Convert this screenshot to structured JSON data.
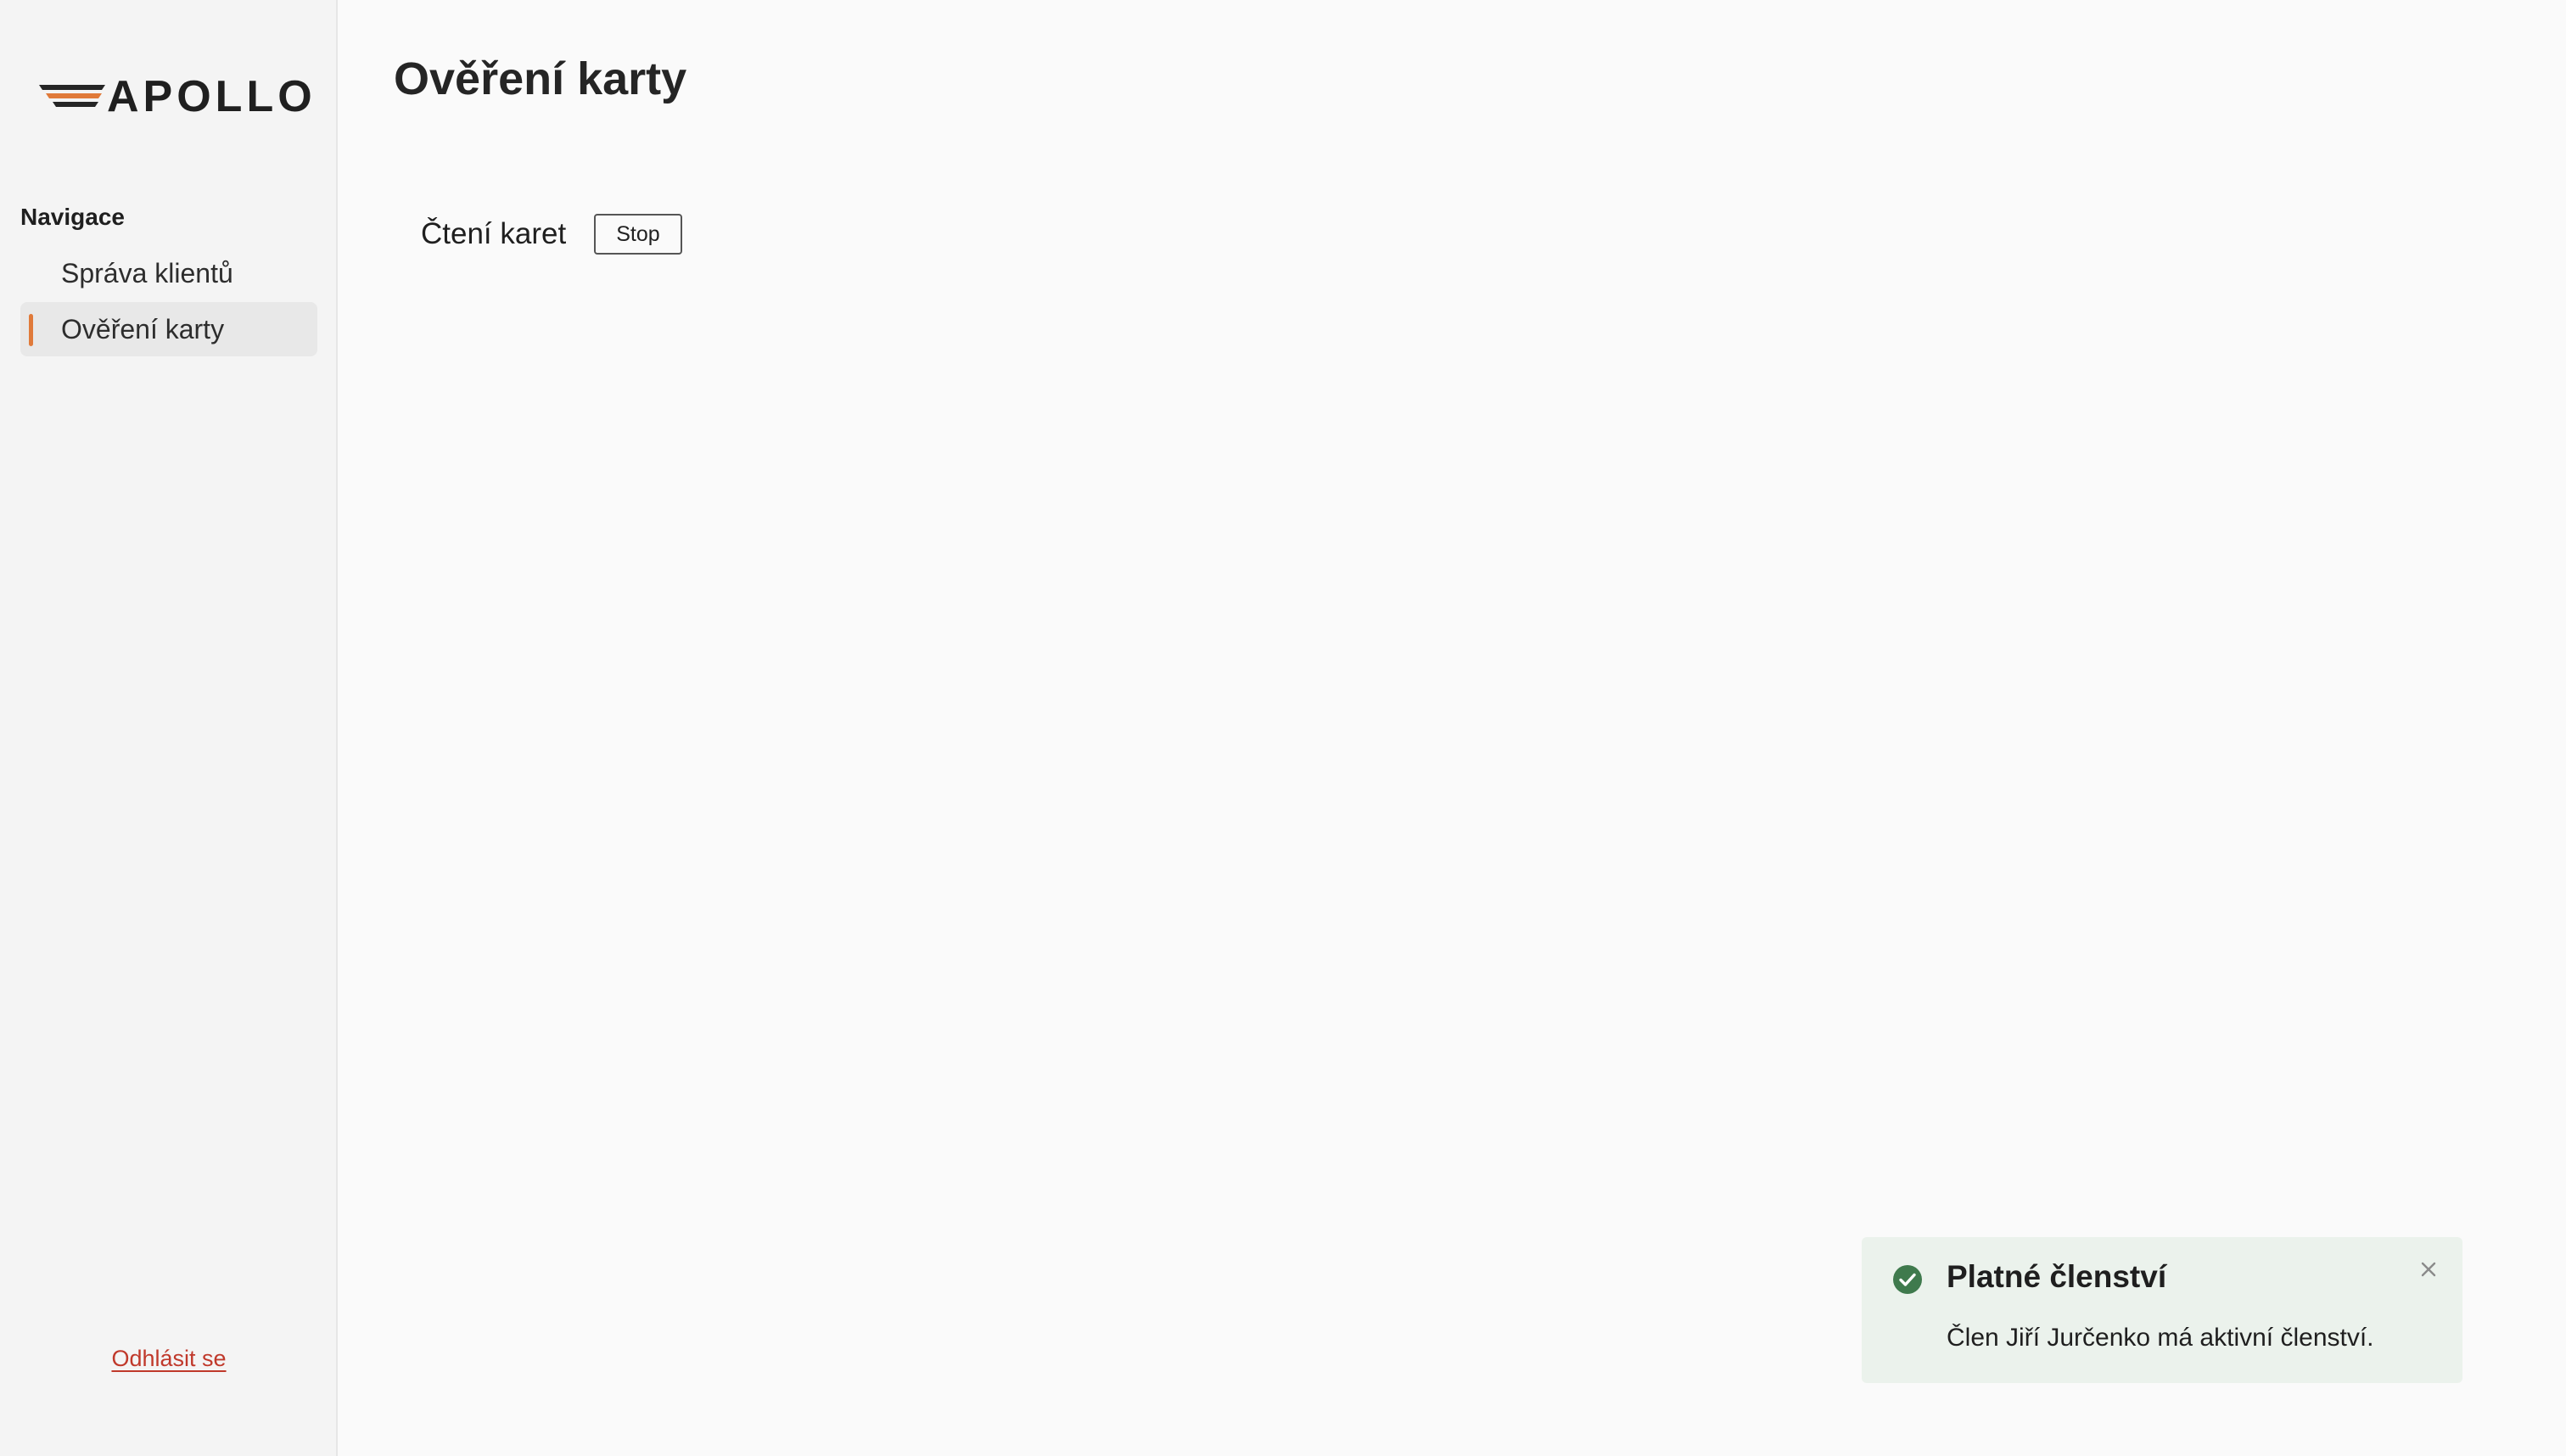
{
  "sidebar": {
    "logo_text": "APOLLO",
    "nav_heading": "Navigace",
    "items": [
      {
        "label": "Správa klientů",
        "active": false
      },
      {
        "label": "Ověření karty",
        "active": true
      }
    ],
    "logout_label": "Odhlásit se"
  },
  "main": {
    "title": "Ověření karty",
    "reader_label": "Čtení karet",
    "stop_label": "Stop"
  },
  "toast": {
    "title": "Platné členství",
    "message": "Člen Jiří Jurčenko má aktivní členství.",
    "icon": "check-circle-icon"
  },
  "colors": {
    "accent": "#e07a3a",
    "success": "#3f7a4d",
    "toast_bg": "#ebf2ec",
    "logout": "#c0392b"
  }
}
